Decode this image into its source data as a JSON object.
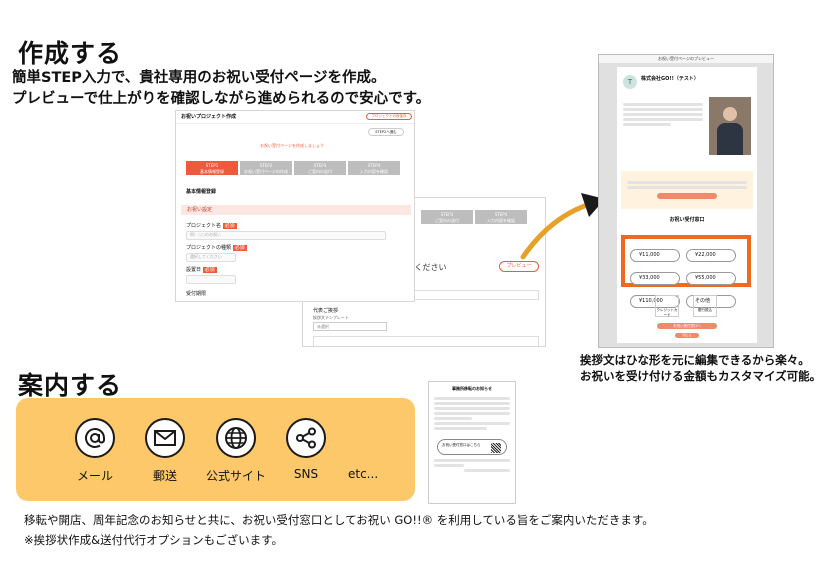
{
  "create_section": {
    "title": "作成する",
    "lead_line1": "簡単STEP入力で、貴社専用のお祝い受付ページを作成。",
    "lead_line2": "プレビューで仕上がりを確認しながら進められるので安心です。"
  },
  "form_screenshot": {
    "title": "お祝いプロジェクト作成",
    "preview_tag": "プロジェクトの仮保存",
    "next_button": "STEP2へ進む",
    "notice": "お祝い受付ページを作成しましょう",
    "steps": [
      {
        "num": "STEP1",
        "label": "基本情報登録",
        "state": "on"
      },
      {
        "num": "STEP2",
        "label": "お祝い受付ページの作成",
        "state": "off"
      },
      {
        "num": "STEP3",
        "label": "ご案内の送付",
        "state": "off"
      },
      {
        "num": "STEP4",
        "label": "入力内容を確認",
        "state": "off"
      }
    ],
    "section_label": "基本情報登録",
    "group_label": "お祝い設定",
    "project_name_label": "プロジェクト名",
    "project_name_placeholder": "例）○○のお祝い",
    "project_type_label": "プロジェクトの種類",
    "project_type_placeholder": "選択してください",
    "date_label": "設置日",
    "period_label": "受付期限",
    "required_badge": "必須"
  },
  "form_back_screenshot": {
    "steps": [
      {
        "num": "STEP3",
        "label": "ご案内の送付"
      },
      {
        "num": "STEP4",
        "label": "入力内容を確認"
      }
    ],
    "heading": "してください",
    "preview_button": "プレビュー",
    "greeting_label": "代表ご挨拶",
    "template_label": "挨拶文テンプレート",
    "template_select": "未選択"
  },
  "preview_screenshot": {
    "title": "お祝い受付ページのプレビュー",
    "company": "株式会社GO!!（テスト）",
    "give_title": "お祝い受付窓口",
    "amounts": [
      "¥11,000",
      "¥22,000",
      "¥33,000",
      "¥55,000",
      "¥110,000"
    ],
    "other_label": "その他",
    "pay_card": "クレジットカード",
    "pay_bank": "銀行振込",
    "cta": "お祝い受付窓口へ",
    "close": "閉じる"
  },
  "preview_caption": {
    "line1": "挨拶文はひな形を元に編集できるから楽々。",
    "line2": "お祝いを受け付ける金額もカスタマイズ可能。"
  },
  "guide_section": {
    "title": "案内する",
    "channels": [
      {
        "icon": "at-icon",
        "label": "メール"
      },
      {
        "icon": "mail-icon",
        "label": "郵送"
      },
      {
        "icon": "globe-icon",
        "label": "公式サイト"
      },
      {
        "icon": "share-icon",
        "label": "SNS"
      }
    ],
    "etc": "etc...",
    "footer_line1": "移転や開店、周年記念のお知らせと共に、お祝い受付窓口としてお祝い GO!!® を利用している旨をご案内いただきます。",
    "footer_line2": "※挨拶状作成&送付代行オプションもございます。"
  },
  "letter_doc": {
    "title": "事務所移転のお知らせ",
    "qr_label": "お祝い受付窓口はこちら"
  },
  "colors": {
    "accent": "#f05a3c",
    "banner": "#fdc86a",
    "arrow": "#e7a028"
  }
}
